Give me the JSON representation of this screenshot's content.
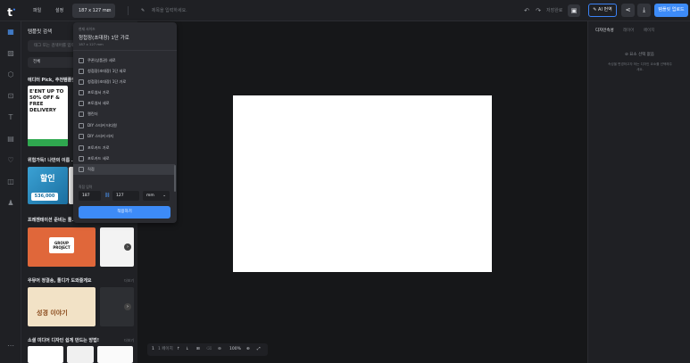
{
  "topbar": {
    "logo": "t",
    "menu_file": "파일",
    "menu_settings": "설정",
    "size_selector": "187 x 127 mm",
    "title_placeholder": "제목을 입력하세요.",
    "saved_status": "저장완료",
    "ai_button": "AI 번역",
    "upload_button": "템플릿 업로드"
  },
  "left_panel": {
    "title": "템플릿 검색",
    "search_placeholder": "태그 또는 검색어를 입력하세요",
    "filter_value": "전체",
    "sections": [
      {
        "title": "에디터 Pick, 추천템플릿",
        "more": "더보기"
      },
      {
        "title": "위험가득! 나만의 이름 …",
        "more": "더보기"
      },
      {
        "title": "프레젠테이션 준비는 툴…",
        "more": "더보기"
      },
      {
        "title": "우뮤어 정결송, 툴디가 도와줄게요",
        "more": "더보기"
      },
      {
        "title": "소셜 미디어 디자인 쉽게 만드는 방법!",
        "more": "더보기"
      }
    ],
    "thumb_texts": {
      "promo_line1": "E'ENT UP TO",
      "promo_line2": "50% OFF &",
      "promo_line3": "FREE",
      "promo_line4": "DELIVERY",
      "price": "536,000",
      "sale": "할인",
      "group": "GROUP\nPROJECT",
      "bible": "성경 이야기"
    }
  },
  "size_dropdown": {
    "current_label": "현재 사이즈",
    "current_name": "청첩장(초대장) 1단 가로",
    "current_size": "187 x 127 mm",
    "items": [
      {
        "label": "쿠폰(상품권) 세로",
        "selected": false
      },
      {
        "label": "청첩장(초대장) 1단 세로",
        "selected": false
      },
      {
        "label": "청첩장(초대장) 1단 가로",
        "selected": false
      },
      {
        "label": "포토엽서 가로",
        "selected": false
      },
      {
        "label": "포토엽서 세로",
        "selected": false
      },
      {
        "label": "캘린더",
        "selected": false
      },
      {
        "label": "DIY 스티커 타다원",
        "selected": false
      },
      {
        "label": "DIY 스티커 라지",
        "selected": false
      },
      {
        "label": "포토카드 가로",
        "selected": false
      },
      {
        "label": "포토카드 세로",
        "selected": false
      },
      {
        "label": "직접",
        "selected": true
      }
    ],
    "custom_label": "직접 입력",
    "width": "187",
    "height": "127",
    "unit": "mm",
    "apply_button": "적용하기"
  },
  "zoombar": {
    "page_num": "1",
    "page_label": "1 페이지",
    "zoom": "100%"
  },
  "right_panel": {
    "tabs": [
      "디자인속성",
      "레이어",
      "페이지"
    ],
    "empty_title": "요소 선택 없음",
    "empty_desc": "속성을 변경하고자 하는 디자인 요소를 선택해주세요."
  },
  "colors": {
    "accent": "#3d8bf7",
    "background": "#1b1c1f",
    "artboard": "#ffffff"
  }
}
